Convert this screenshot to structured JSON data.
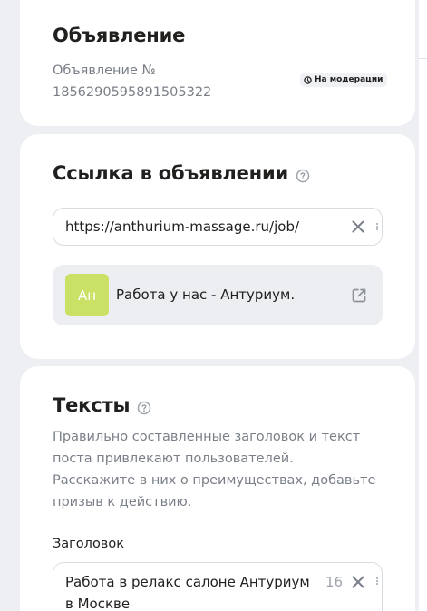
{
  "ad_card": {
    "title": "Объявление",
    "number_label": "Объявление №",
    "number_value": "1856290595891505322",
    "status_badge": "На модерации"
  },
  "link_card": {
    "title": "Ссылка в объявлении",
    "url_value": "https://anthurium-massage.ru/job/",
    "preview": {
      "avatar_initials": "Ан",
      "avatar_color": "#c9e265",
      "title": "Работа у нас - Антуриум."
    }
  },
  "texts_card": {
    "title": "Тексты",
    "description": "Правильно составленные заголовок и текст поста привлекают пользователей. Расскажите в них о преимуществах, добавьте призыв к действию.",
    "headline_label": "Заголовок",
    "headline_value": "Работа в релакс салоне Антуриум в Москве",
    "headline_counter": "16"
  },
  "icons": {
    "badge": "clock-icon",
    "help": "question-circle-icon",
    "clear": "close-icon",
    "open": "external-link-icon"
  }
}
